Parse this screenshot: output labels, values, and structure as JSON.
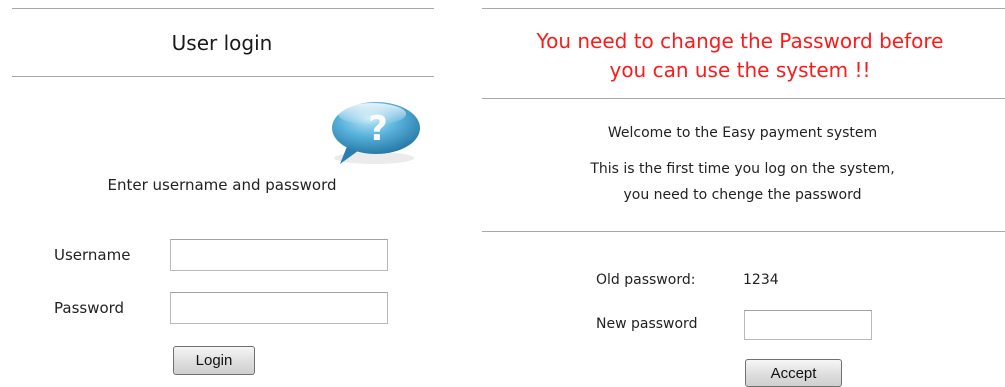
{
  "login_panel": {
    "title": "User login",
    "subtitle": "Enter username and password",
    "username_label": "Username",
    "username_value": "",
    "password_label": "Password",
    "password_value": "",
    "login_button": "Login",
    "help_icon": "question-bubble-icon"
  },
  "change_password_panel": {
    "warning_line1": "You need to change the Password before",
    "warning_line2": "you can use the system !!",
    "welcome": "Welcome to the Easy payment system",
    "first_time_line1": "This is the first time you log on the system,",
    "first_time_line2": "you need to chenge the password",
    "old_password_label": "Old password:",
    "old_password_value": "1234",
    "new_password_label": "New password",
    "new_password_value": "",
    "accept_button": "Accept"
  },
  "colors": {
    "warning": "#ff1a1a",
    "rule": "#a8a8a8",
    "icon_blue": "#2e8fc0"
  }
}
